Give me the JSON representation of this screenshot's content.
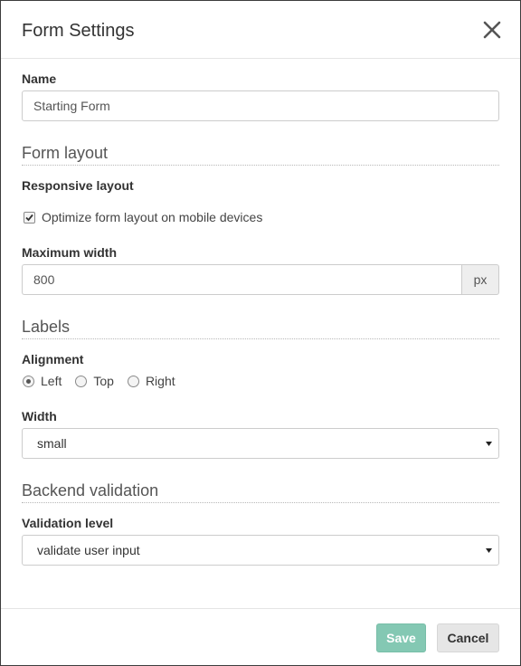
{
  "dialog": {
    "title": "Form Settings"
  },
  "name_field": {
    "label": "Name",
    "value": "Starting Form"
  },
  "form_layout": {
    "section_title": "Form layout",
    "responsive_label": "Responsive layout",
    "optimize_checkbox": {
      "label": "Optimize form layout on mobile devices",
      "checked": true
    },
    "max_width": {
      "label": "Maximum width",
      "value": "800",
      "unit": "px"
    }
  },
  "labels": {
    "section_title": "Labels",
    "alignment": {
      "label": "Alignment",
      "options": [
        "Left",
        "Top",
        "Right"
      ],
      "selected": "Left"
    },
    "width": {
      "label": "Width",
      "value": "small"
    }
  },
  "backend_validation": {
    "section_title": "Backend validation",
    "validation_level": {
      "label": "Validation level",
      "value": "validate user input"
    }
  },
  "footer": {
    "save_label": "Save",
    "cancel_label": "Cancel"
  },
  "colors": {
    "save_button": "#84c8b3",
    "cancel_button": "#e6e6e6"
  },
  "icons": {
    "close": "close-icon",
    "select_caret": "caret-down-icon",
    "checkbox": "checkmark-icon"
  }
}
